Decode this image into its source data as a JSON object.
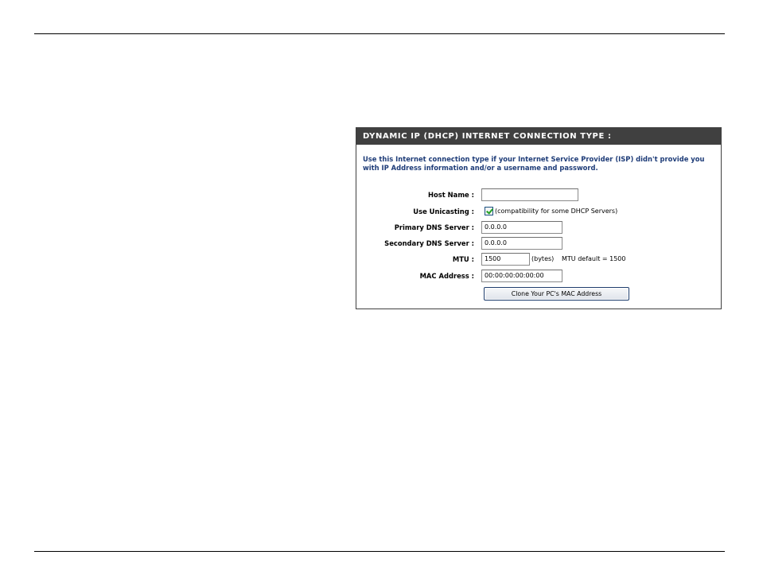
{
  "section": {
    "title": "DYNAMIC IP (DHCP) INTERNET CONNECTION TYPE :",
    "description": "Use this Internet connection type if your Internet Service Provider (ISP) didn't provide you with IP Address information and/or a username and password."
  },
  "fields": {
    "host_name": {
      "label": "Host Name :",
      "value": ""
    },
    "use_unicasting": {
      "label": "Use Unicasting :",
      "checked": true,
      "hint": "(compatibility for some DHCP Servers)"
    },
    "primary_dns": {
      "label": "Primary DNS Server :",
      "value": "0.0.0.0"
    },
    "secondary_dns": {
      "label": "Secondary DNS Server :",
      "value": "0.0.0.0"
    },
    "mtu": {
      "label": "MTU :",
      "value": "1500",
      "unit": "(bytes)",
      "default_note": "MTU default = 1500"
    },
    "mac_address": {
      "label": "MAC Address :",
      "value": "00:00:00:00:00:00"
    }
  },
  "buttons": {
    "clone_mac": "Clone Your PC's MAC Address"
  },
  "colors": {
    "header_bg": "#404040",
    "header_text": "#ffffff",
    "description_text": "#1e3c78",
    "checkbox_tick": "#21a121"
  }
}
